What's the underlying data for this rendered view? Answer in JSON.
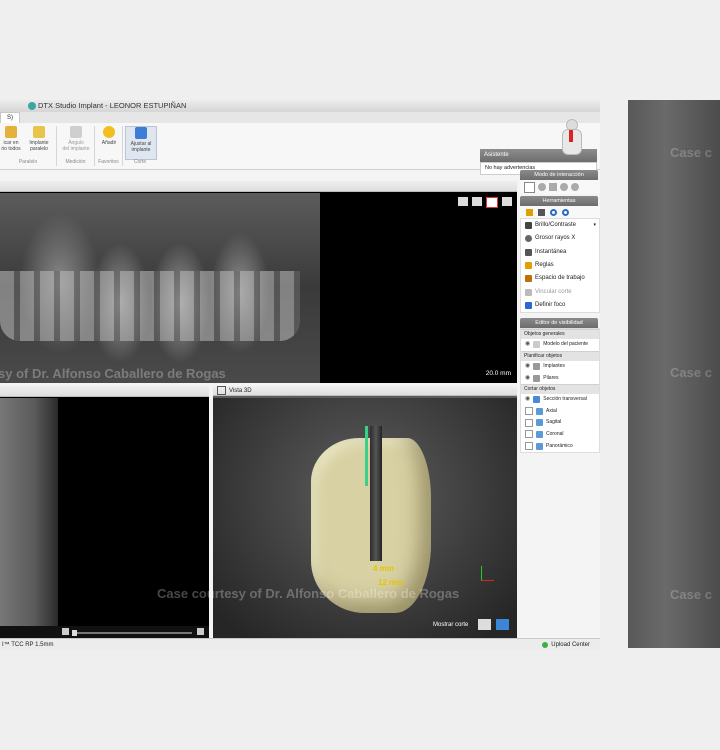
{
  "window": {
    "title": "DTX Studio Implant - LEONOR ESTUPIÑAN",
    "tab_label": "S)"
  },
  "ribbon": {
    "buttons": [
      {
        "label": "icar en\nrio todos",
        "icon": "parallel-all-icon"
      },
      {
        "label": "Implante\nparalelo",
        "icon": "parallel-implant-icon"
      },
      {
        "label": "Ángulo\ndel implante",
        "icon": "angle-icon"
      },
      {
        "label": "Añadir",
        "icon": "star-add-icon"
      },
      {
        "label": "Ajustar al\nimplante",
        "icon": "fit-implant-icon"
      }
    ],
    "groups": [
      "Paralelo",
      "Medición",
      "Favoritos",
      "Corte"
    ]
  },
  "assistant": {
    "title": "Asistente",
    "message": "No hay advertencias"
  },
  "panorama": {
    "watermark": "sy of Dr. Alfonso Caballero de Rogas",
    "scale": "20.0 mm"
  },
  "view3d": {
    "title": "Vista 3D",
    "watermark": "Case courtesy of Dr. Alfonso Caballero de Rogas",
    "measure1": "4 mm",
    "measure2": "12 mm",
    "show_cut": "Mostrar corte"
  },
  "statusbar": {
    "left": "I™ TCC RP 1.5mm",
    "right": "Upload Center"
  },
  "side_panel": {
    "interaction_title": "Modo de interacción",
    "tools_title": "Herramientas",
    "tools": [
      {
        "label": "Brillo/Contraste",
        "icon": "brightness-icon",
        "color": "#444"
      },
      {
        "label": "Grosor rayos X",
        "icon": "xray-icon",
        "color": "#666"
      },
      {
        "label": "Instantánea",
        "icon": "snapshot-icon",
        "color": "#555"
      },
      {
        "label": "Reglas",
        "icon": "ruler-icon",
        "color": "#e0a000"
      },
      {
        "label": "Espacio de trabajo",
        "icon": "workspace-icon",
        "color": "#c07000"
      },
      {
        "label": "Vincular corte",
        "icon": "link-icon",
        "color": "#aaa"
      },
      {
        "label": "Definir foco",
        "icon": "focus-icon",
        "color": "#2a6ad0"
      }
    ],
    "visibility_title": "Editor de visibilidad",
    "sections": [
      {
        "header": "Objetos generales",
        "items": [
          "Modelo del paciente"
        ]
      },
      {
        "header": "Planificar objetos",
        "items": [
          "Implantes",
          "Pilares"
        ]
      },
      {
        "header": "Cortar objetos",
        "items": [
          "Sección transversal",
          "Axial",
          "Sagital",
          "Coronal",
          "Panorámico"
        ]
      }
    ]
  },
  "right_view": {
    "watermarks": [
      "Case c",
      "Case c",
      "Case c"
    ]
  }
}
